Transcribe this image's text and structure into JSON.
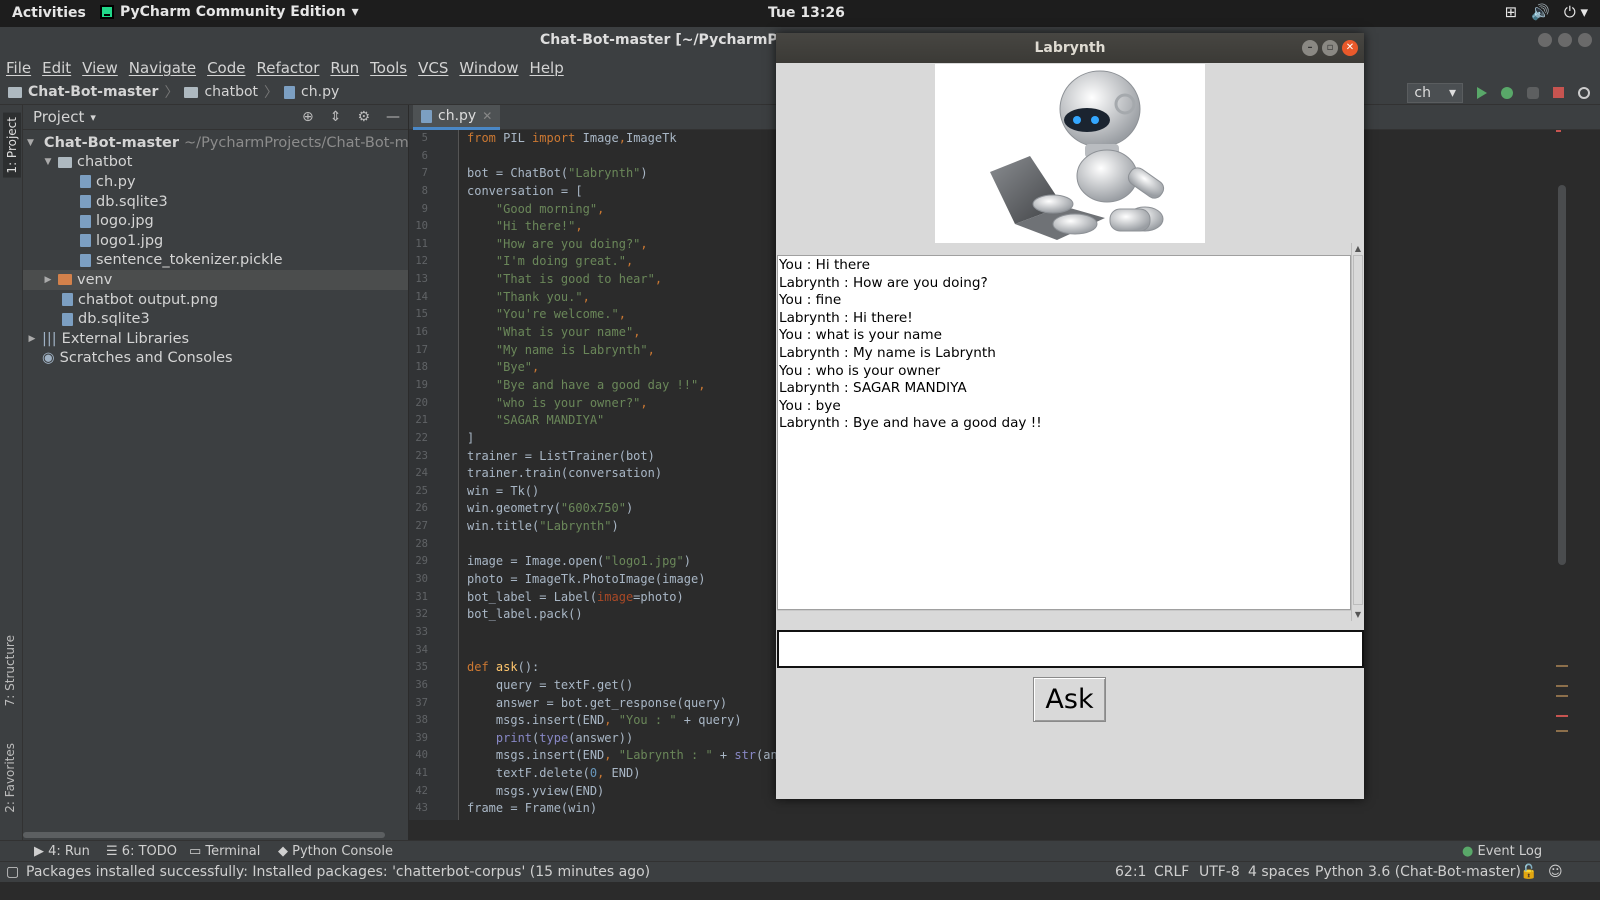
{
  "system": {
    "activities": "Activities",
    "app_name": "PyCharm Community Edition",
    "clock": "Tue 13:26"
  },
  "ide": {
    "title": "Chat-Bot-master [~/PycharmProject",
    "menu": [
      "File",
      "Edit",
      "View",
      "Navigate",
      "Code",
      "Refactor",
      "Run",
      "Tools",
      "VCS",
      "Window",
      "Help"
    ],
    "breadcrumb": [
      "Chat-Bot-master",
      "chatbot",
      "ch.py"
    ],
    "run_config": "ch",
    "project_panel_title": "Project",
    "tree": [
      {
        "label": "Chat-Bot-master",
        "path": "~/PycharmProjects/Chat-Bot-mas",
        "level": 0,
        "type": "folder",
        "expanded": true
      },
      {
        "label": "chatbot",
        "level": 1,
        "type": "folder",
        "expanded": true
      },
      {
        "label": "ch.py",
        "level": 2,
        "type": "file"
      },
      {
        "label": "db.sqlite3",
        "level": 2,
        "type": "file"
      },
      {
        "label": "logo.jpg",
        "level": 2,
        "type": "file"
      },
      {
        "label": "logo1.jpg",
        "level": 2,
        "type": "file"
      },
      {
        "label": "sentence_tokenizer.pickle",
        "level": 2,
        "type": "file"
      },
      {
        "label": "venv",
        "level": 1,
        "type": "folder-orange",
        "expanded": false
      },
      {
        "label": "chatbot output.png",
        "level": 1,
        "type": "file"
      },
      {
        "label": "db.sqlite3",
        "level": 1,
        "type": "file"
      },
      {
        "label": "External Libraries",
        "level": 0,
        "type": "lib",
        "expanded": false
      },
      {
        "label": "Scratches and Consoles",
        "level": 0,
        "type": "scratch"
      }
    ],
    "editor_tab": "ch.py",
    "line_numbers": [
      5,
      6,
      7,
      8,
      9,
      10,
      11,
      12,
      13,
      14,
      15,
      16,
      17,
      18,
      19,
      20,
      21,
      22,
      23,
      24,
      25,
      26,
      27,
      28,
      29,
      30,
      31,
      32,
      33,
      34,
      35,
      36,
      37,
      38,
      39,
      40,
      41,
      42,
      43
    ],
    "left_tabs": [
      "1: Project",
      "7: Structure",
      "2: Favorites"
    ],
    "bottom_tabs": [
      "4: Run",
      "6: TODO",
      "Terminal",
      "Python Console"
    ],
    "event_log": "Event Log",
    "status_message": "Packages installed successfully: Installed packages: 'chatterbot-corpus' (15 minutes ago)",
    "status_items": [
      "62:1",
      "CRLF",
      "UTF-8",
      "4 spaces",
      "Python 3.6 (Chat-Bot-master)"
    ]
  },
  "chat_window": {
    "title": "Labrynth",
    "messages": [
      "You : Hi there",
      "Labrynth : How are you doing?",
      "You : fine",
      "Labrynth : Hi there!",
      "You : what is your name",
      "Labrynth : My name is Labrynth",
      "You : who is your owner",
      "Labrynth : SAGAR MANDIYA",
      "You : bye",
      "Labrynth : Bye and have a good day !!"
    ],
    "input_value": "",
    "ask_button": "Ask"
  },
  "colors": {
    "ide_bg": "#2b2b2b",
    "panel_bg": "#3c3f41",
    "keyword": "#cc7832",
    "string": "#6a8759",
    "tk_bg": "#d9d9d9"
  }
}
